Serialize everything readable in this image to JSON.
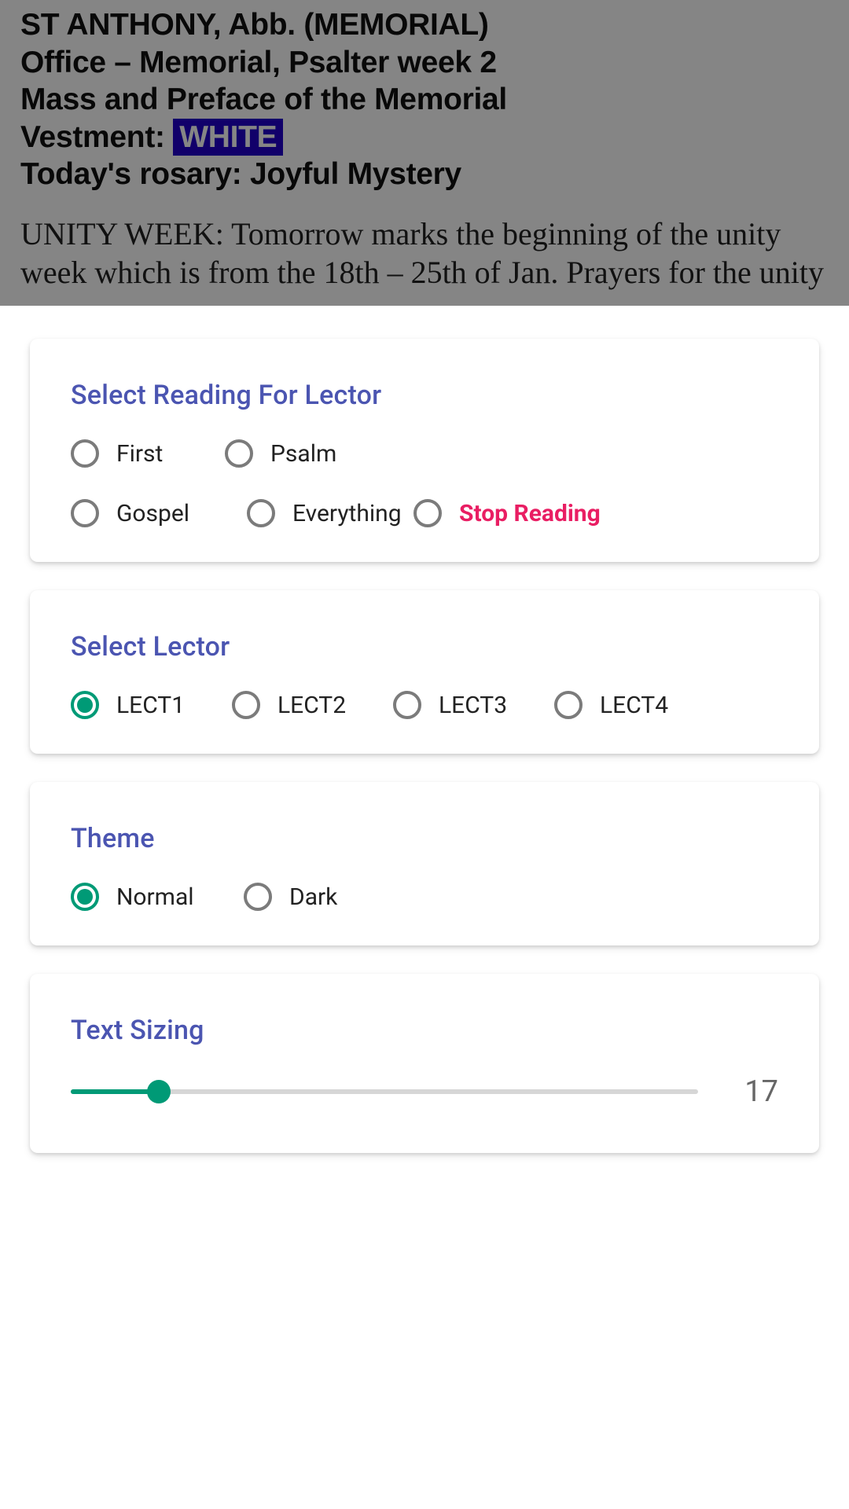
{
  "backdrop": {
    "line1": "ST ANTHONY, Abb. (MEMORIAL)",
    "line2": "Office – Memorial, Psalter week 2",
    "line3": "Mass and Preface of the Memorial",
    "vestment_label": "Vestment: ",
    "vestment_value": "WHITE",
    "line5": "Today's rosary: Joyful Mystery",
    "body": "UNITY WEEK: Tomorrow marks the beginning of the unity week which is from the 18th – 25th of Jan. Prayers for the unity"
  },
  "reading": {
    "title": "Select Reading For Lector",
    "options": {
      "first": "First",
      "psalm": "Psalm",
      "gospel": "Gospel",
      "everything": "Everything",
      "stop": "Stop Reading"
    }
  },
  "lector": {
    "title": "Select Lector",
    "options": {
      "l1": "LECT1",
      "l2": "LECT2",
      "l3": "LECT3",
      "l4": "LECT4"
    },
    "selected": "l1"
  },
  "theme": {
    "title": "Theme",
    "options": {
      "normal": "Normal",
      "dark": "Dark"
    },
    "selected": "normal"
  },
  "textsize": {
    "title": "Text Sizing",
    "value": "17"
  }
}
